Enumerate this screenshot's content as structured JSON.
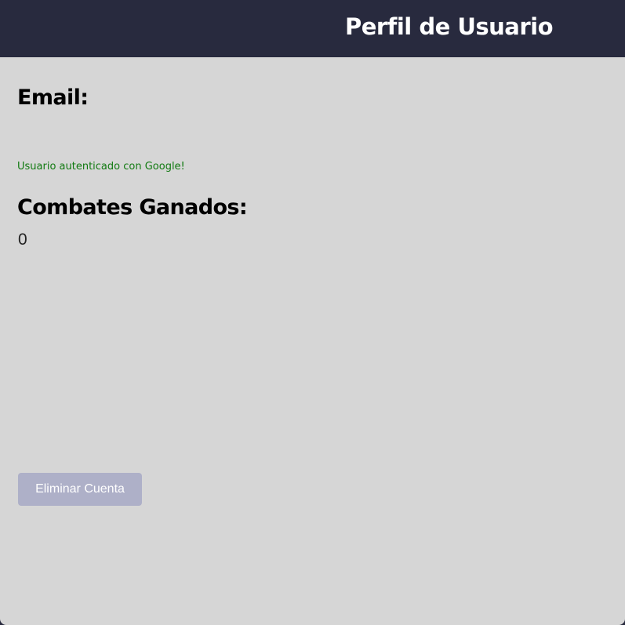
{
  "header": {
    "title": "Perfil de Usuario"
  },
  "profile": {
    "email_label": "Email:",
    "auth_status": "Usuario autenticado con Google!",
    "combat_label": "Combates Ganados:",
    "combat_wins": "0"
  },
  "actions": {
    "delete_account_label": "Eliminar Cuenta"
  },
  "colors": {
    "header_bg": "#282a3e",
    "page_bg": "#d6d6d6",
    "success_text": "#117a11",
    "button_bg": "#aeb0c8"
  }
}
